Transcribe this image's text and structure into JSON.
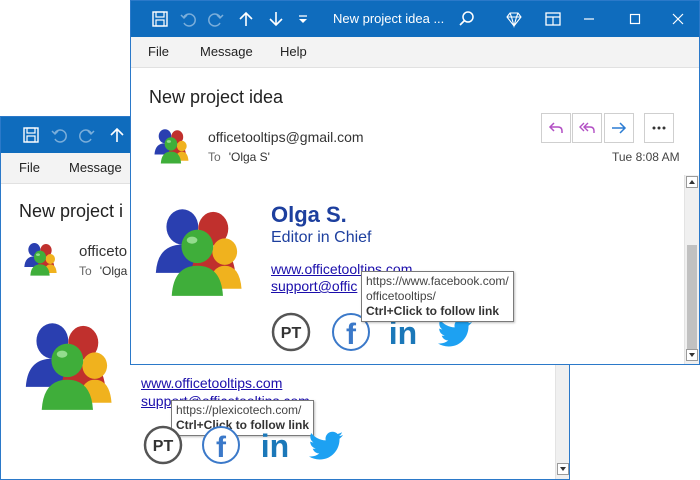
{
  "back_window": {
    "menu": [
      "File",
      "Message"
    ],
    "subject": "New project i",
    "from": "officeto",
    "to_label": "To",
    "to_value": "'Olga",
    "links": [
      "www.officetooltips.com",
      "support@officetooltips.com"
    ],
    "tooltip": {
      "url": "https://plexicotech.com/",
      "hint": "Ctrl+Click to follow link"
    }
  },
  "front_window": {
    "title": "New project idea ...",
    "menu": [
      "File",
      "Message",
      "Help"
    ],
    "subject": "New project idea",
    "from": "officetooltips@gmail.com",
    "to_label": "To",
    "to_value": "'Olga S'",
    "date": "Tue 8:08 AM",
    "signature": {
      "name": "Olga S.",
      "role": "Editor in Chief",
      "links": [
        "www.officetooltips.com",
        "support@offic"
      ]
    },
    "tooltip": {
      "url_line1": "https://www.facebook.com/",
      "url_line2": "officetooltips/",
      "hint": "Ctrl+Click to follow link"
    }
  },
  "social": {
    "pt": "PT",
    "facebook": "f",
    "linkedin": "in"
  },
  "icons": [
    "save-icon",
    "undo-icon",
    "redo-icon",
    "up-arrow-icon",
    "down-arrow-icon",
    "more-dropdown-icon",
    "search-icon",
    "diamond-icon",
    "window-mode-icon",
    "minimize-icon",
    "maximize-icon",
    "close-icon",
    "reply-icon",
    "reply-all-icon",
    "forward-icon",
    "more-options-icon"
  ],
  "colors": {
    "titlebar": "#0f6cbd",
    "reply_accent": "#b24fc4",
    "forward_accent": "#2b7cd3",
    "name": "#1d3f9e",
    "link": "#1a0dab"
  }
}
